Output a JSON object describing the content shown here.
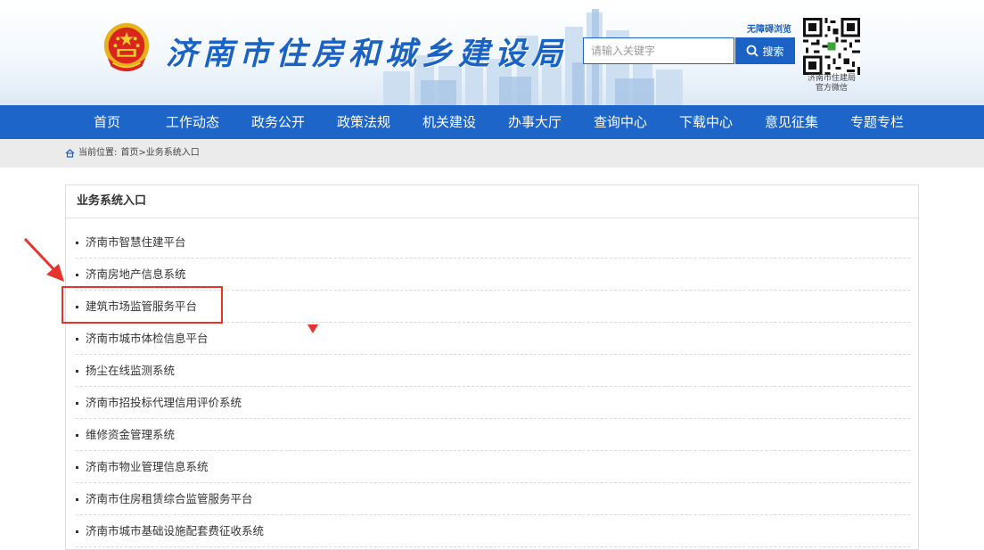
{
  "header": {
    "site_title": "济南市住房和城乡建设局",
    "accessibility_label": "无障碍浏览",
    "search_placeholder": "请输入关键字",
    "search_button_label": "搜索",
    "qr_caption_line1": "济南市住建局",
    "qr_caption_line2": "官方微信"
  },
  "nav": {
    "items": [
      {
        "label": "首页"
      },
      {
        "label": "工作动态"
      },
      {
        "label": "政务公开"
      },
      {
        "label": "政策法规"
      },
      {
        "label": "机关建设"
      },
      {
        "label": "办事大厅"
      },
      {
        "label": "查询中心"
      },
      {
        "label": "下载中心"
      },
      {
        "label": "意见征集"
      },
      {
        "label": "专题专栏"
      }
    ]
  },
  "breadcrumb": {
    "prefix": "当前位置:",
    "home": "首页",
    "separator": ">",
    "current": "业务系统入口"
  },
  "panel": {
    "title": "业务系统入口",
    "items": [
      {
        "label": "济南市智慧住建平台"
      },
      {
        "label": "济南房地产信息系统"
      },
      {
        "label": "建筑市场监管服务平台"
      },
      {
        "label": "济南市城市体检信息平台"
      },
      {
        "label": "扬尘在线监测系统"
      },
      {
        "label": "济南市招投标代理信用评价系统"
      },
      {
        "label": "维修资金管理系统"
      },
      {
        "label": "济南市物业管理信息系统"
      },
      {
        "label": "济南市住房租赁综合监管服务平台"
      },
      {
        "label": "济南市城市基础设施配套费征收系统"
      }
    ]
  },
  "colors": {
    "brand_blue": "#1d65c9",
    "highlight_red": "#e8332c",
    "breadcrumb_bg": "#ebebeb"
  }
}
